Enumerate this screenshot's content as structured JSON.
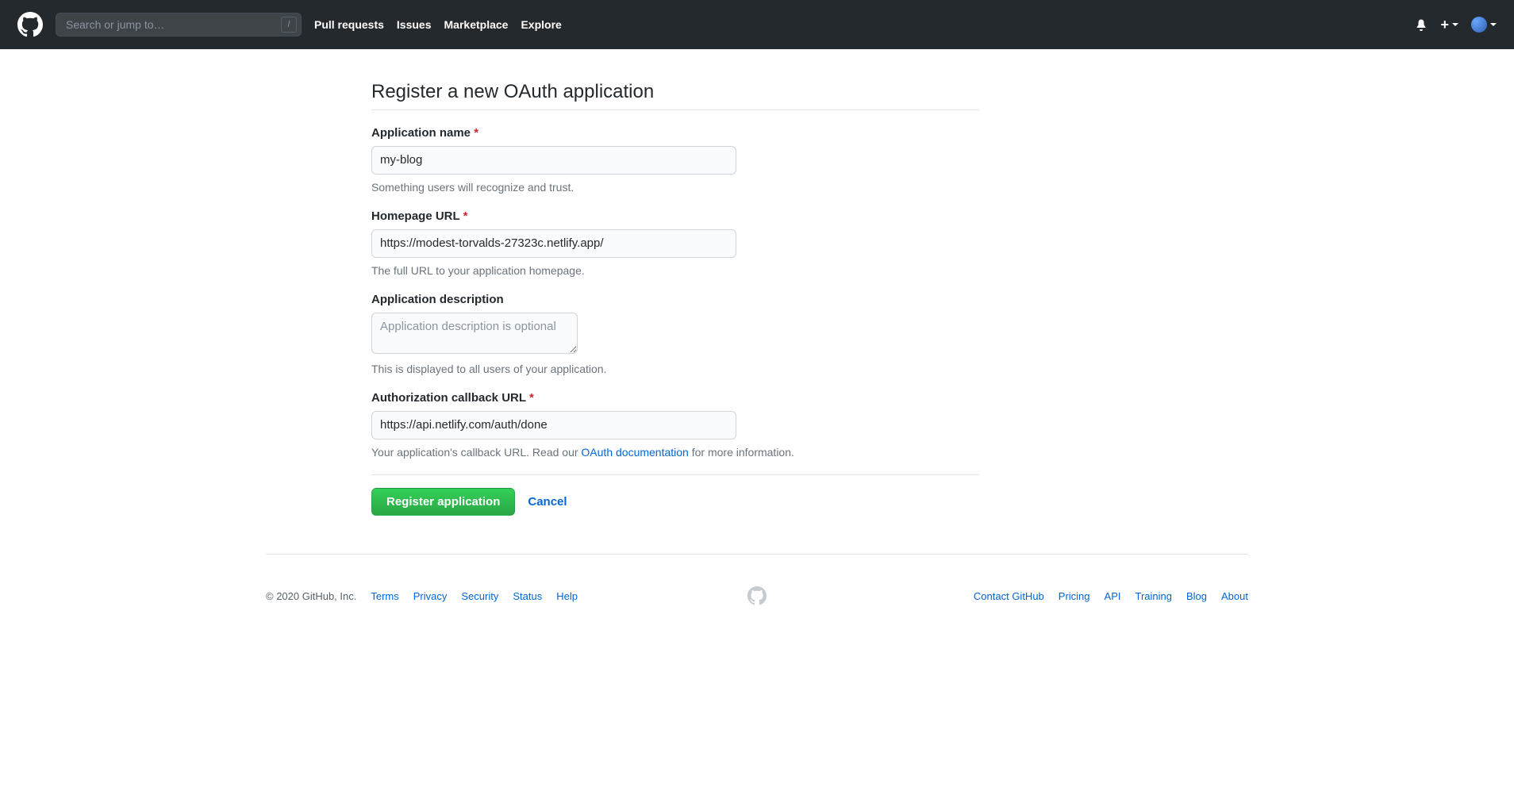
{
  "header": {
    "search_placeholder": "Search or jump to…",
    "slash_key": "/",
    "nav": {
      "pull_requests": "Pull requests",
      "issues": "Issues",
      "marketplace": "Marketplace",
      "explore": "Explore"
    },
    "plus_sign": "+"
  },
  "page": {
    "title": "Register a new OAuth application"
  },
  "form": {
    "app_name": {
      "label": "Application name",
      "required_star": "*",
      "value": "my-blog",
      "hint": "Something users will recognize and trust."
    },
    "homepage_url": {
      "label": "Homepage URL",
      "required_star": "*",
      "value": "https://modest-torvalds-27323c.netlify.app/",
      "hint": "The full URL to your application homepage."
    },
    "description": {
      "label": "Application description",
      "placeholder": "Application description is optional",
      "value": "",
      "hint": "This is displayed to all users of your application."
    },
    "callback_url": {
      "label": "Authorization callback URL",
      "required_star": "*",
      "value": "https://api.netlify.com/auth/done",
      "hint_prefix": "Your application's callback URL. Read our ",
      "hint_link": "OAuth documentation",
      "hint_suffix": " for more information."
    },
    "submit_label": "Register application",
    "cancel_label": "Cancel"
  },
  "footer": {
    "copyright": "© 2020 GitHub, Inc.",
    "left": {
      "terms": "Terms",
      "privacy": "Privacy",
      "security": "Security",
      "status": "Status",
      "help": "Help"
    },
    "right": {
      "contact": "Contact GitHub",
      "pricing": "Pricing",
      "api": "API",
      "training": "Training",
      "blog": "Blog",
      "about": "About"
    }
  }
}
